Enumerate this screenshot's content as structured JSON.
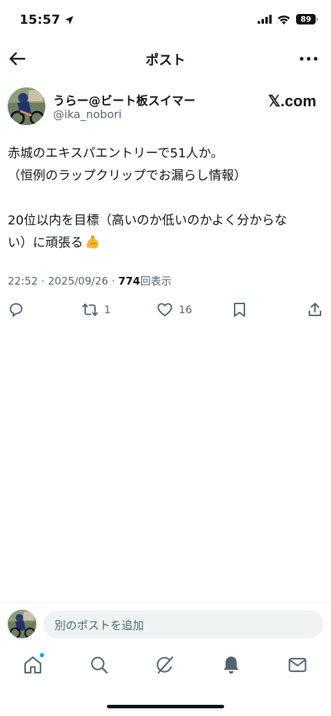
{
  "status_bar": {
    "time": "15:57",
    "battery": "89"
  },
  "header": {
    "title": "ポスト"
  },
  "author": {
    "name": "うらー@ビート板スイマー",
    "handle": "@ika_nobori",
    "site_label": "𝕏.com"
  },
  "post": {
    "lines": [
      "赤城のエキスパエントリーで51人か。",
      "（恒例のラップクリップでお漏らし情報）",
      "",
      "20位以内を目標（高いのか低いのかよく分からな",
      "い）に頑張る"
    ]
  },
  "meta": {
    "time": "22:52",
    "date": "2025/09/26",
    "separator": "·",
    "views_count": "774",
    "views_label": "回表示"
  },
  "actions": {
    "retweet_count": "1",
    "like_count": "16"
  },
  "reply_bar": {
    "placeholder": "別のポストを追加"
  },
  "colors": {
    "text": "#0f1419",
    "secondary": "#536471",
    "accent": "#1d9bf0",
    "input_bg": "#eff3f4"
  },
  "icons": {
    "tabs": [
      "home-icon",
      "search-icon",
      "grok-icon",
      "notifications-icon",
      "messages-icon"
    ]
  }
}
